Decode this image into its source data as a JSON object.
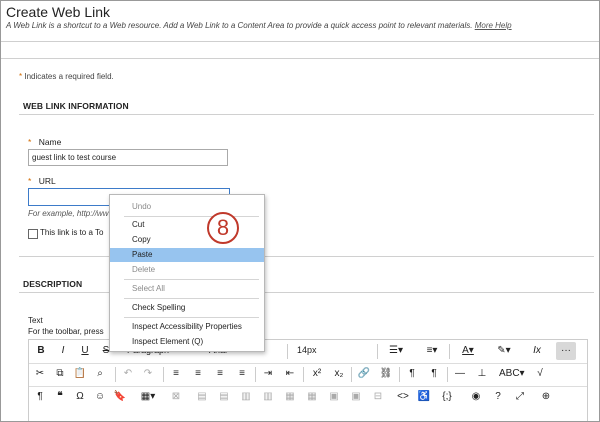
{
  "header": {
    "title": "Create Web Link",
    "subtitle": "A Web Link is a shortcut to a Web resource. Add a Web Link to a Content Area to provide a quick access point to relevant materials.",
    "help_link": "More Help"
  },
  "form": {
    "required_note": "Indicates a required field.",
    "required_mark": "*",
    "section_weblink": "WEB LINK INFORMATION",
    "name_label": "Name",
    "name_value": "guest link to test course",
    "url_label": "URL",
    "url_value": "",
    "url_hint": "For example, http://ww",
    "tool_checkbox_label": "This link is to a To",
    "section_description": "DESCRIPTION",
    "text_label": "Text",
    "toolbar_hint": "For the toolbar, press"
  },
  "editor": {
    "row1": {
      "bold": "B",
      "italic": "I",
      "underline": "U",
      "strike": "S",
      "format": "Paragraph",
      "font": "Arial",
      "size": "14px",
      "more": "···"
    },
    "row2": {
      "superscript": "x²",
      "subscript": "x₂"
    }
  },
  "context_menu": {
    "items": [
      "Undo",
      "Cut",
      "Copy",
      "Paste",
      "Delete",
      "Select All",
      "Check Spelling",
      "Inspect Accessibility Properties",
      "Inspect Element (Q)"
    ],
    "highlighted": "Paste",
    "disabled": [
      "Undo",
      "Delete",
      "Select All"
    ]
  },
  "step_badge": "8",
  "colors": {
    "accent": "#3d7bc9",
    "menu_highlight": "#97c4ef",
    "required": "#d36b00",
    "badge": "#c0392b"
  }
}
